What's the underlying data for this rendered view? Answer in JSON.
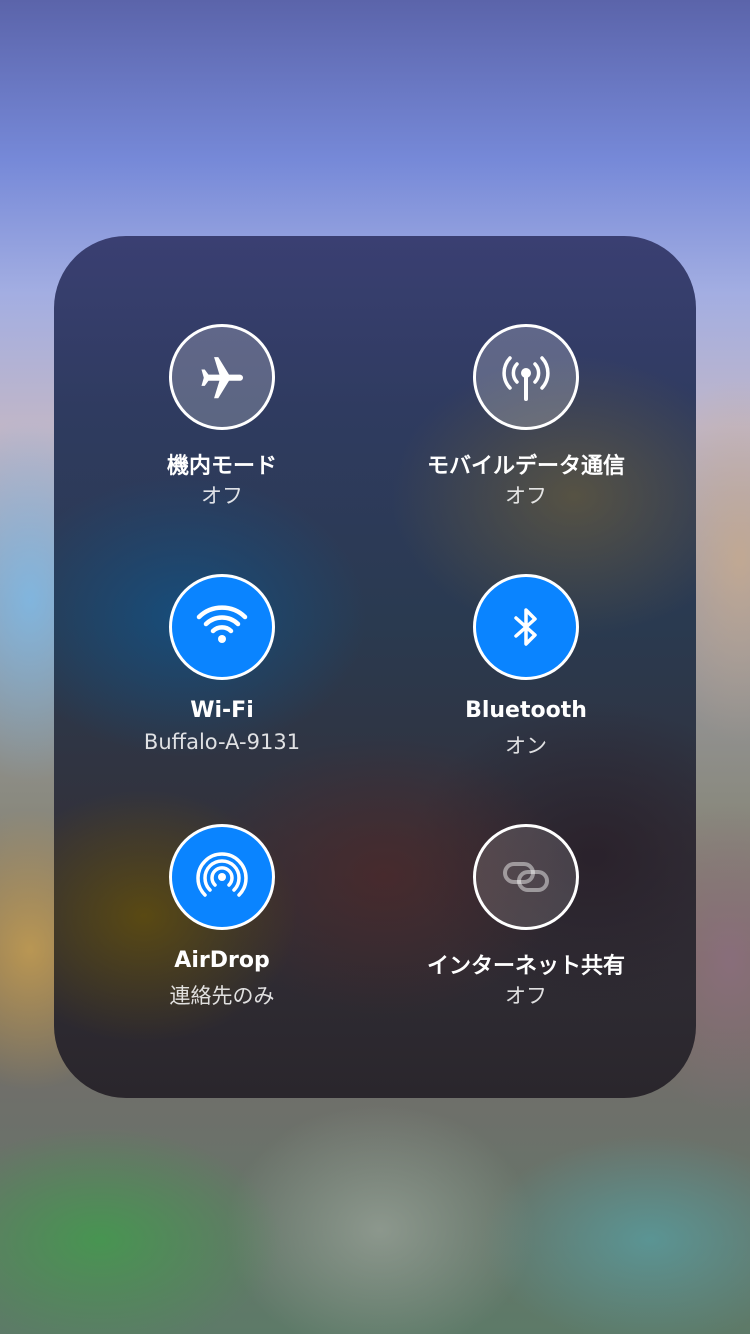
{
  "connectivity": {
    "airplane": {
      "label": "機内モード",
      "status": "オフ",
      "state": "off",
      "icon": "airplane-icon"
    },
    "cellular": {
      "label": "モバイルデータ通信",
      "status": "オフ",
      "state": "off",
      "icon": "cellular-antenna-icon"
    },
    "wifi": {
      "label": "Wi-Fi",
      "status": "Buffalo-A-9131",
      "state": "on",
      "icon": "wifi-icon"
    },
    "bluetooth": {
      "label": "Bluetooth",
      "status": "オン",
      "state": "on",
      "icon": "bluetooth-icon"
    },
    "airdrop": {
      "label": "AirDrop",
      "status": "連絡先のみ",
      "state": "on",
      "icon": "airdrop-icon"
    },
    "hotspot": {
      "label": "インターネット共有",
      "status": "オフ",
      "state": "off",
      "icon": "link-chain-icon"
    }
  },
  "colors": {
    "active": "#0a84ff",
    "inactive_border": "#ffffff"
  }
}
